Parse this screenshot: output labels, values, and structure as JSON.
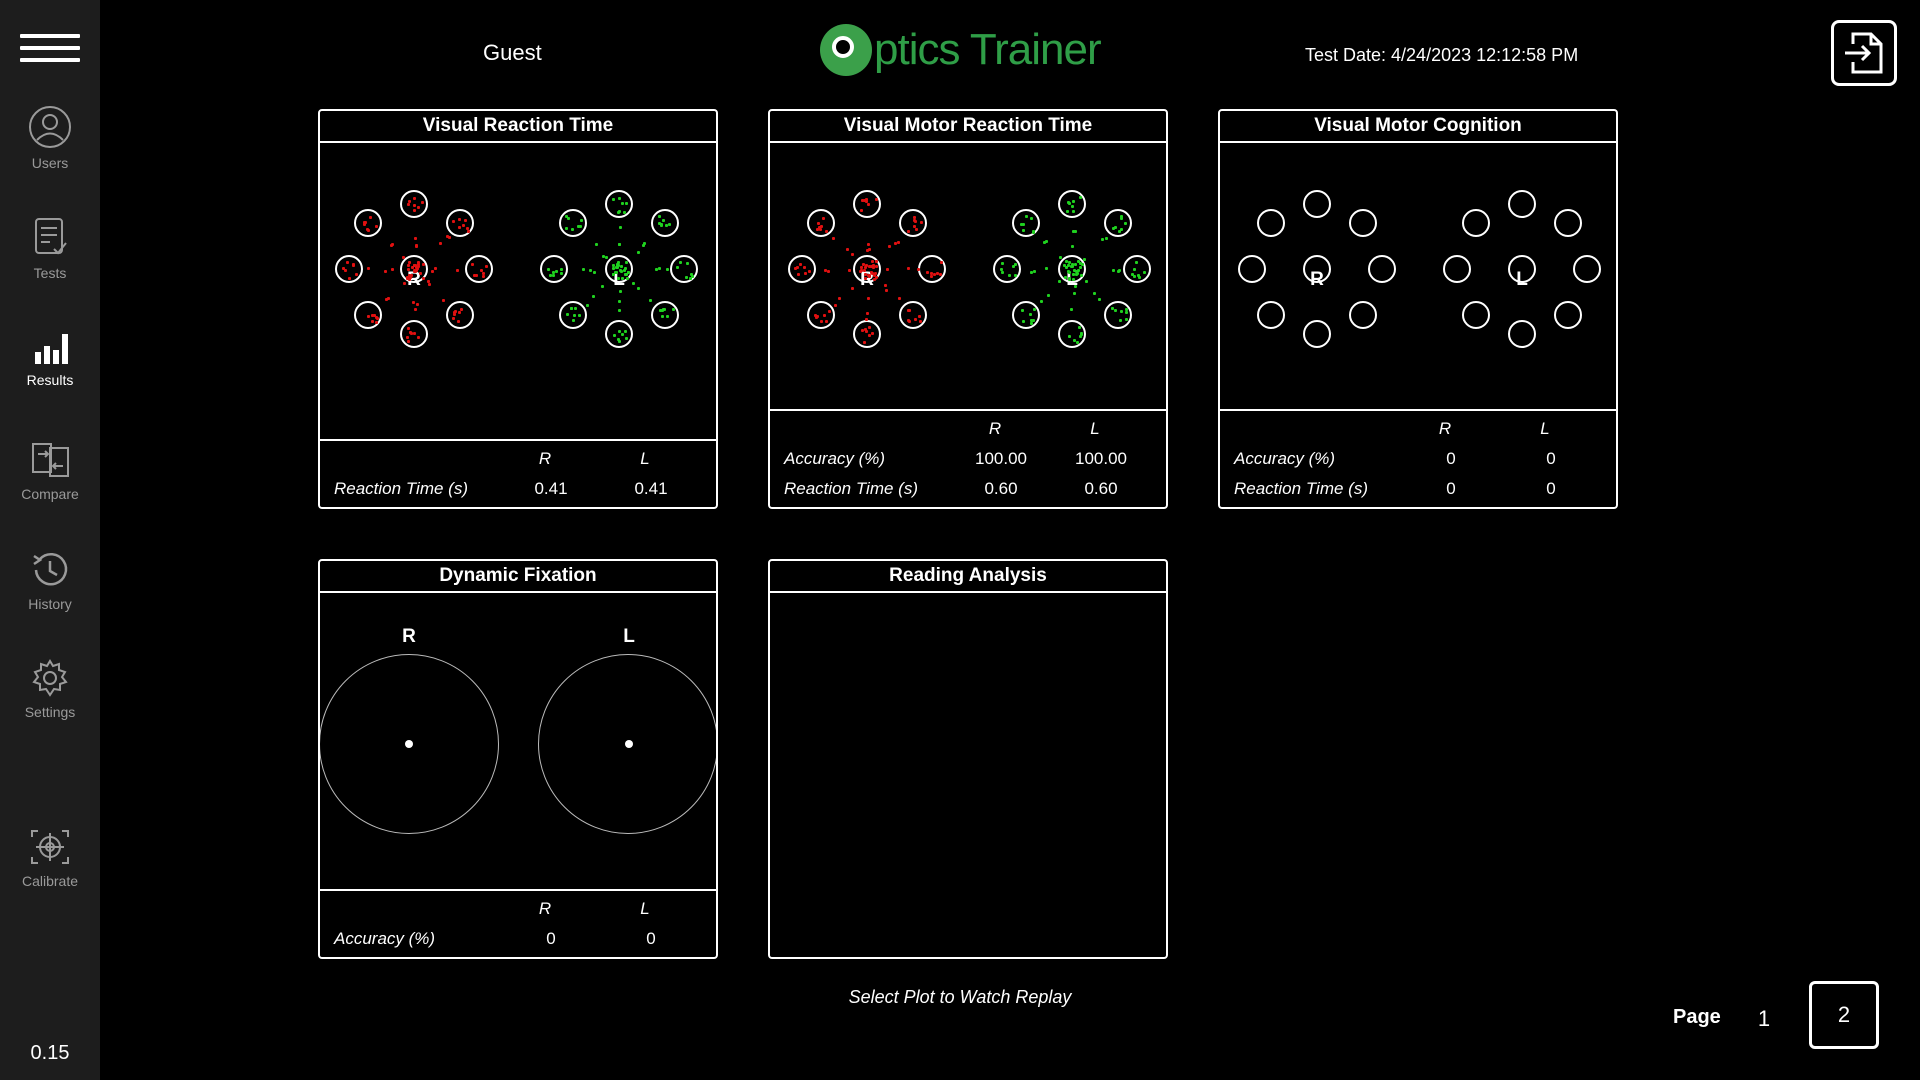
{
  "header": {
    "username": "Guest",
    "logo_text": "ptics Trainer",
    "test_date": "Test Date: 4/24/2023 12:12:58 PM",
    "colors": {
      "logo_green": "#2f9e47"
    }
  },
  "sidebar": {
    "items": [
      {
        "label": "Users",
        "icon": "user-icon"
      },
      {
        "label": "Tests",
        "icon": "clipboard-check-icon"
      },
      {
        "label": "Results",
        "icon": "bar-chart-icon",
        "active": true
      },
      {
        "label": "Compare",
        "icon": "compare-icon"
      },
      {
        "label": "History",
        "icon": "history-icon"
      },
      {
        "label": "Settings",
        "icon": "gear-icon"
      },
      {
        "label": "Calibrate",
        "icon": "crosshair-icon"
      }
    ],
    "version": "0.15"
  },
  "panels": {
    "vrt": {
      "title": "Visual Reaction Time",
      "eye_r": "R",
      "eye_l": "L",
      "col_r": "R",
      "col_l": "L",
      "row1_label": "Reaction Time (s)",
      "row1_r": "0.41",
      "row1_l": "0.41"
    },
    "vmrt": {
      "title": "Visual Motor Reaction Time",
      "eye_r": "R",
      "eye_l": "L",
      "col_r": "R",
      "col_l": "L",
      "row1_label": "Accuracy (%)",
      "row1_r": "100.00",
      "row1_l": "100.00",
      "row2_label": "Reaction Time (s)",
      "row2_r": "0.60",
      "row2_l": "0.60"
    },
    "vmc": {
      "title": "Visual Motor Cognition",
      "eye_r": "R",
      "eye_l": "L",
      "col_r": "R",
      "col_l": "L",
      "row1_label": "Accuracy (%)",
      "row1_r": "0",
      "row1_l": "0",
      "row2_label": "Reaction Time (s)",
      "row2_r": "0",
      "row2_l": "0"
    },
    "df": {
      "title": "Dynamic Fixation",
      "eye_r": "R",
      "eye_l": "L",
      "col_r": "R",
      "col_l": "L",
      "row1_label": "Accuracy (%)",
      "row1_r": "0",
      "row1_l": "0"
    },
    "ra": {
      "title": "Reading Analysis"
    }
  },
  "footer": {
    "hint": "Select Plot to Watch Replay",
    "page_label": "Page",
    "pages": [
      "1",
      "2"
    ],
    "current_page": "2"
  },
  "colors": {
    "right_eye": "#e01010",
    "left_eye": "#1fd11f"
  }
}
